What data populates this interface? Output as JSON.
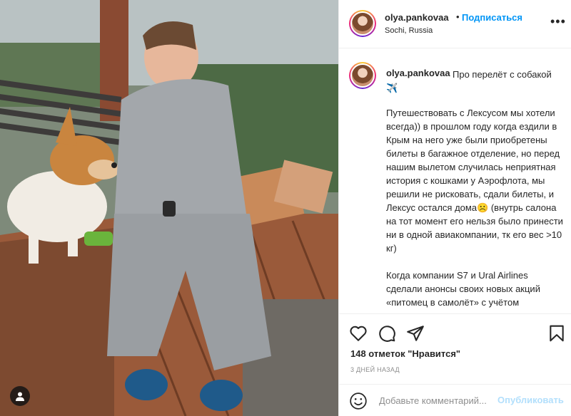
{
  "header": {
    "username": "olya.pankovaa",
    "dot": "•",
    "follow_label": "Подписаться",
    "location": "Sochi, Russia",
    "more_label": "•••"
  },
  "caption": {
    "username": "olya.pankovaa",
    "title": "Про перелёт с собакой ✈️",
    "paragraphs": [
      "Путешествовать с Лексусом мы хотели всегда)) в прошлом году когда ездили в Крым на него уже были приобретены билеты в багажное отделение, но перед нашим вылетом случилась неприятная история с кошками у Аэрофлота, мы решили не рисковать, сдали билеты, и Лексус остался дома☹️ (внутрь салона на тот момент его нельзя было принести ни в одной авиакомпании, тк его вес >10 кг)",
      "Когда компании S7 и Ural Airlines сделали анонсы своих новых акций «питомец в самолёт» с учётом"
    ]
  },
  "actions": {
    "likes_text": "148 отметок \"Нравится\"",
    "time_text": "3 ДНЕЙ НАЗАД"
  },
  "comment": {
    "placeholder": "Добавьте комментарий...",
    "publish_label": "Опубликовать"
  },
  "icons": [
    "heart-icon",
    "comment-icon",
    "share-icon",
    "bookmark-icon",
    "emoji-icon",
    "user-tag-icon",
    "more-icon"
  ],
  "colors": {
    "accent": "#0095f6",
    "publish_disabled": "#b2dffc",
    "muted": "#8e8e8e",
    "text": "#262626"
  }
}
